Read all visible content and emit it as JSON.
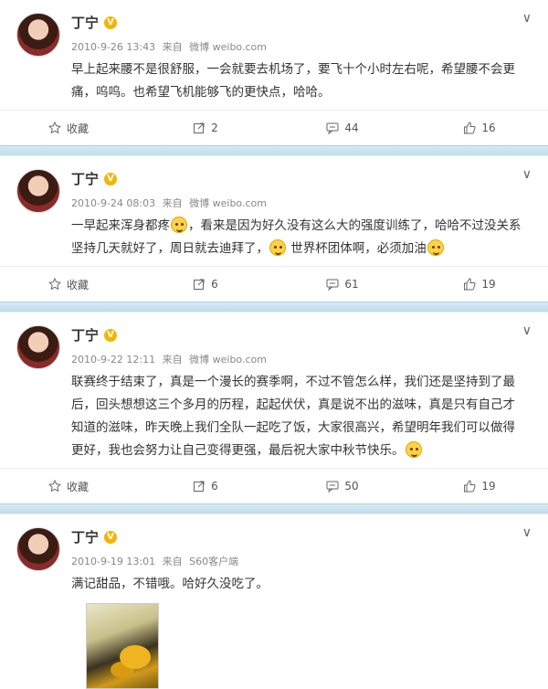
{
  "posts": [
    {
      "author": "丁宁",
      "verified_badge": "V",
      "time": "2010-9-26 13:43",
      "source_prefix": "来自",
      "source": "微博 weibo.com",
      "text": "早上起来腰不是很舒服，一会就要去机场了，要飞十个小时左右呢，希望腰不会更痛，呜呜。也希望飞机能够飞的更快点，哈哈。",
      "collect_label": "收藏",
      "repost_count": "2",
      "comment_count": "44",
      "like_count": "16"
    },
    {
      "author": "丁宁",
      "verified_badge": "V",
      "time": "2010-9-24 08:03",
      "source_prefix": "来自",
      "source": "微博 weibo.com",
      "text_a": "一早起来浑身都疼",
      "text_b": "，看来是因为好久没有这么大的强度训练了，哈哈不过没关系坚持几天就好了，周日就去迪拜了，",
      "text_c": "世界杯团体啊，必须加油",
      "collect_label": "收藏",
      "repost_count": "6",
      "comment_count": "61",
      "like_count": "19"
    },
    {
      "author": "丁宁",
      "verified_badge": "V",
      "time": "2010-9-22 12:11",
      "source_prefix": "来自",
      "source": "微博 weibo.com",
      "text": "联赛终于结束了，真是一个漫长的赛季啊，不过不管怎么样，我们还是坚持到了最后，回头想想这三个多月的历程，起起伏伏，真是说不出的滋味，真是只有自己才知道的滋味，昨天晚上我们全队一起吃了饭，大家很高兴，希望明年我们可以做得更好，我也会努力让自己变得更强，最后祝大家中秋节快乐。",
      "collect_label": "收藏",
      "repost_count": "6",
      "comment_count": "50",
      "like_count": "19"
    },
    {
      "author": "丁宁",
      "verified_badge": "V",
      "time": "2010-9-19 13:01",
      "source_prefix": "来自",
      "source": "S60客户端",
      "text": "满记甜品，不错哦。哈好久没吃了。"
    }
  ],
  "icons": {
    "more": "chevron-down-icon",
    "collect": "star-icon",
    "repost": "repost-icon",
    "comment": "comment-icon",
    "like": "thumbs-up-icon",
    "emoji": "emoji-icon"
  },
  "colors": {
    "separator": "#bfdcea",
    "verified": "#f6b400"
  }
}
